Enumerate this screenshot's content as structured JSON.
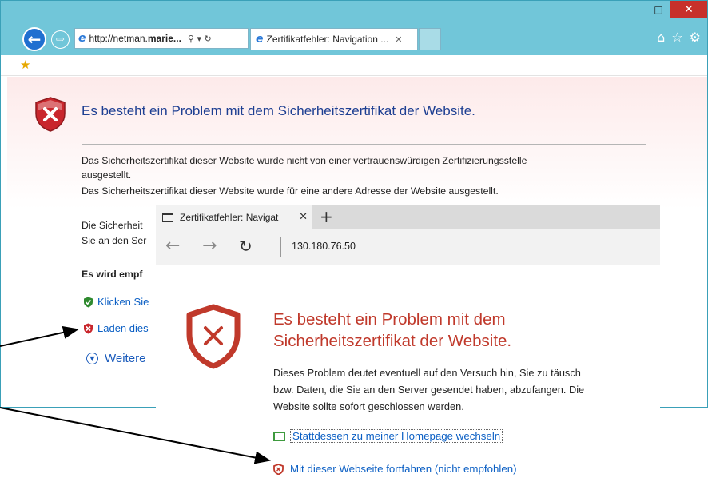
{
  "ie": {
    "address": "http://netman.marie...",
    "address_bold": "marie...",
    "address_prefix": "http://netman.",
    "address_icons": "⚲ ▾ ↻",
    "tab_title": "Zertifikatfehler: Navigation ...",
    "heading": "Es besteht ein Problem mit dem Sicherheitszertifikat der Website.",
    "body_line1": "Das Sicherheitszertifikat dieser Website wurde nicht von einer vertrauenswürdigen Zertifizierungsstelle",
    "body_line2": "ausgestellt.",
    "body_line3": "Das Sicherheitszertifikat dieser Website wurde für eine andere Adresse der Website ausgestellt.",
    "body_line4": "Die Sicherheit",
    "body_line5": "Sie an den Ser",
    "recommend": "Es wird empf",
    "link_close": "Klicken Sie",
    "link_continue": "Laden dies",
    "more_info": "Weitere"
  },
  "edge": {
    "tab_title": "Zertifikatfehler: Navigat",
    "address": "130.180.76.50",
    "heading_line1": "Es besteht ein Problem mit dem",
    "heading_line2": "Sicherheitszertifikat der Website.",
    "body_line1": "Dieses Problem deutet eventuell auf den Versuch hin, Sie zu täusch",
    "body_line2": "bzw. Daten, die Sie an den Server gesendet haben, abzufangen. Die",
    "body_line3": "Website sollte sofort geschlossen werden.",
    "home_link": "Stattdessen zu meiner Homepage wechseln",
    "continue_link": "Mit dieser Webseite fortfahren (nicht empfohlen)"
  },
  "colors": {
    "ie_titlebar": "#71c6d9",
    "ie_heading": "#1e3f92",
    "edge_heading": "#c0392b",
    "link": "#0b5fc4",
    "close_button": "#c7302b"
  },
  "icons": [
    "back-arrow-icon",
    "forward-arrow-icon",
    "ie-logo-icon",
    "home-icon",
    "favorites-star-icon",
    "settings-gear-icon",
    "error-shield-icon",
    "green-shield-icon",
    "red-shield-icon",
    "chevron-down-icon",
    "refresh-icon",
    "tab-page-icon",
    "new-tab-plus-icon"
  ]
}
